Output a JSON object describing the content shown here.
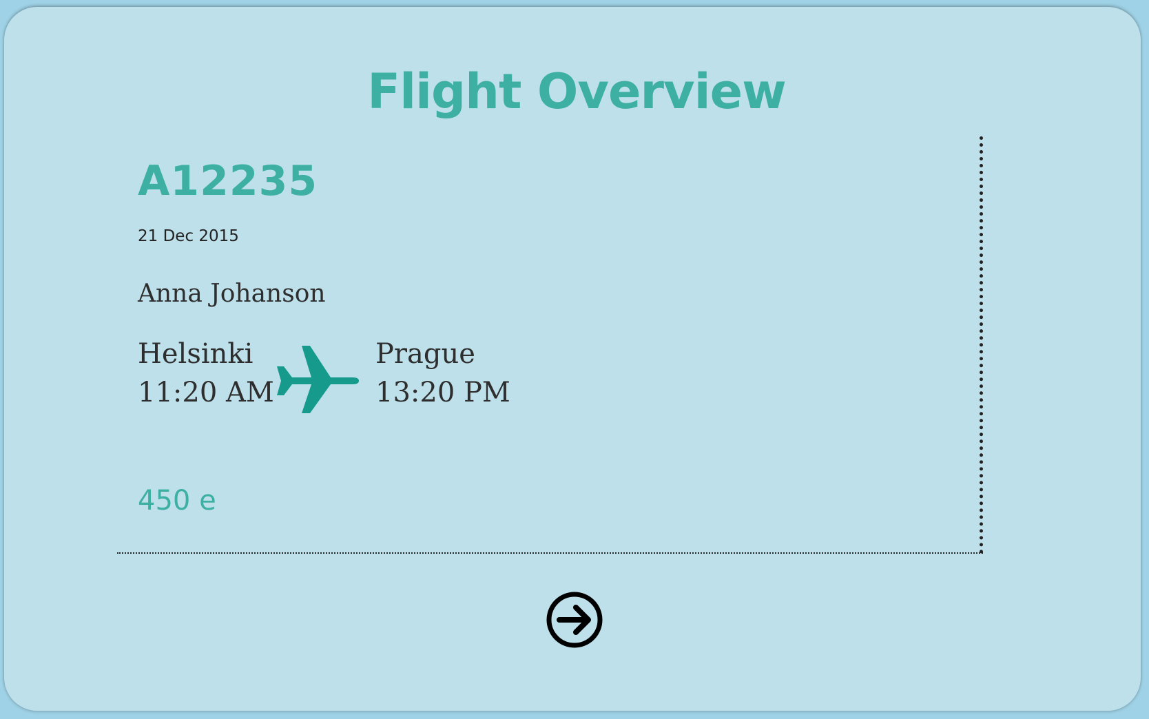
{
  "page": {
    "title": "Flight Overview"
  },
  "ticket": {
    "flight_code": "A12235",
    "date": "21 Dec 2015",
    "passenger": "Anna Johanson",
    "departure": {
      "city": "Helsinki",
      "time": "11:20 AM"
    },
    "arrival": {
      "city": "Prague",
      "time": "13:20 PM"
    },
    "price": "450 e"
  },
  "icons": {
    "plane": "airplane-icon",
    "next": "arrow-right-circle-icon"
  },
  "colors": {
    "background": "#9fd2e6",
    "card": "#bee0eb",
    "accent": "#3db0a3",
    "plane": "#159a8c",
    "text": "#2e2e2e"
  }
}
